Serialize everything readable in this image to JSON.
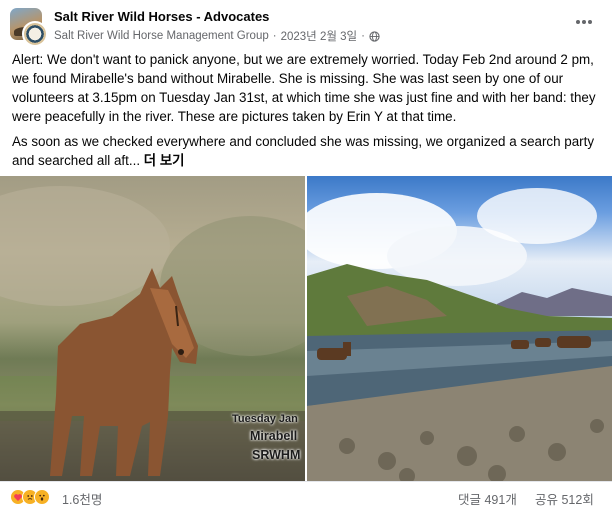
{
  "post": {
    "group_name": "Salt River Wild Horses - Advocates",
    "author": "Salt River Wild Horse Management Group",
    "separator": "·",
    "date": "2023년 2월 3일",
    "dot": "·",
    "privacy_icon": "globe-icon",
    "more_icon": "more-horizontal-icon",
    "paragraph_1": "Alert: We don't want to panick anyone, but we are extremely worried. Today Feb 2nd around 2 pm, we found Mirabelle's band without Mirabelle. She is missing. She was last seen by one of our volunteers at 3.15pm on Tuesday Jan 31st, at which time she was just fine and with her band: they were peacefully in the river. These are pictures taken by Erin Y at that time.",
    "paragraph_2": "As soon as we checked everywhere and concluded she was missing, we organized a search party and searched all aft...",
    "see_more": "더 보기"
  },
  "photos": {
    "left": {
      "subject": "foal-photo",
      "watermark_line_1": "Tuesday Jan",
      "watermark_line_2": "Mirabell",
      "watermark_line_3": "SRWHM"
    },
    "right": {
      "subject": "river-herd-photo"
    }
  },
  "engagement": {
    "reaction_icons": [
      "care-reaction-icon",
      "sad-reaction-icon",
      "wow-reaction-icon"
    ],
    "reaction_count": "1.6천명",
    "comments": "댓글 491개",
    "shares": "공유 512회"
  },
  "colors": {
    "text_primary": "#050505",
    "text_secondary": "#65676b",
    "divider": "#e4e6eb",
    "sad_yellow": "#f7b125",
    "care_red": "#f33e58"
  }
}
